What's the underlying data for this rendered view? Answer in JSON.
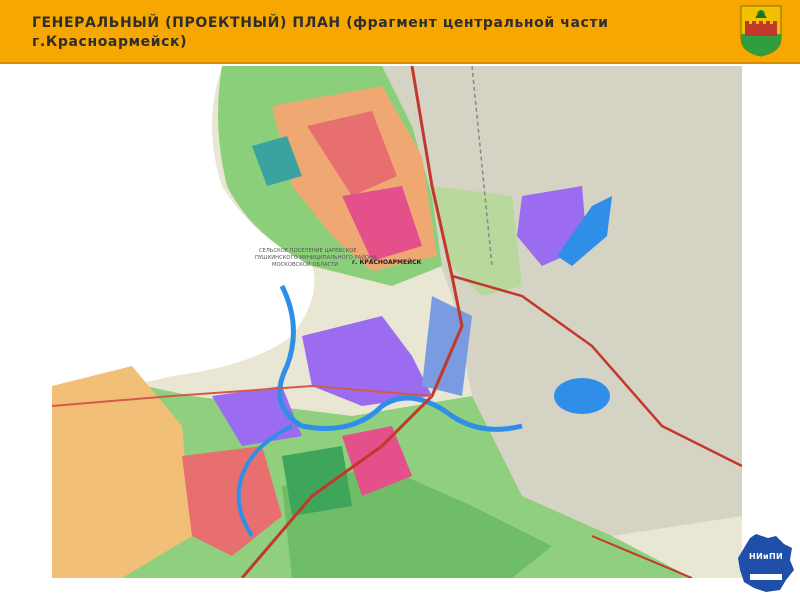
{
  "header": {
    "title": "ГЕНЕРАЛЬНЫЙ (ПРОЕКТНЫЙ) ПЛАН (фрагмент центральной части г.Красноармейск)"
  },
  "map": {
    "labels": {
      "settlement_line1": "СЕЛЬСКОЕ ПОСЕЛЕНИЕ ЦАРЕВСКОЕ",
      "settlement_line2": "ПУШКИНСКОГО МУНИЦИПАЛЬНОГО РАЙОНА",
      "settlement_line3": "МОСКОВСКОЙ ОБЛАСТИ",
      "city": "г. КРАСНОАРМЕЙСК"
    },
    "colors": {
      "background": "#ecead4",
      "water": "#2f8fe8",
      "green_zone": "#5dbb63",
      "residential": "#f4a460",
      "public": "#e4508a",
      "industrial": "#9b59d6",
      "road": "#c0392b"
    }
  },
  "logo": {
    "text": "НИиПИ",
    "icon": "moscow-region-silhouette-icon"
  },
  "crest": {
    "icon": "krasnoarmeysk-coat-of-arms-icon",
    "colors": [
      "#f2c200",
      "#2e9e3e",
      "#c0392b"
    ]
  }
}
